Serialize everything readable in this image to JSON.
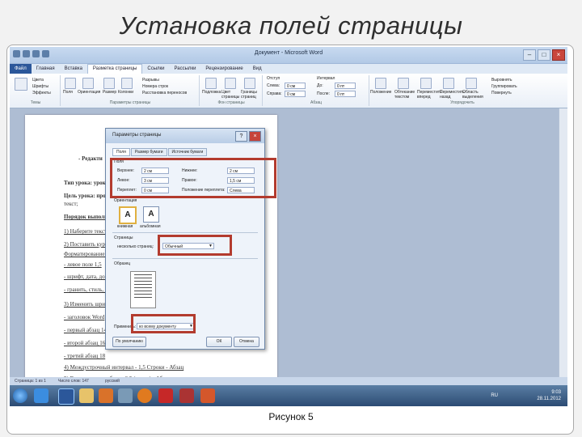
{
  "slide": {
    "title": "Установка полей страницы",
    "caption": "Рисунок 5"
  },
  "word": {
    "window_title": "Документ - Microsoft Word",
    "tabs": [
      "Файл",
      "Главная",
      "Вставка",
      "Разметка страницы",
      "Ссылки",
      "Рассылки",
      "Рецензирование",
      "Вид"
    ],
    "active_tab": "Разметка страницы",
    "ribbon": {
      "themes": {
        "label": "Темы",
        "items": [
          "Цвета",
          "Шрифты",
          "Эффекты"
        ]
      },
      "page_setup": {
        "label": "Параметры страницы",
        "items": [
          "Поля",
          "Ориентация",
          "Размер",
          "Колонки",
          "Разрывы",
          "Номера строк",
          "Расстановка переносов"
        ]
      },
      "page_background": {
        "label": "Фон страницы",
        "items": [
          "Подложка",
          "Цвет страницы",
          "Границы страниц"
        ]
      },
      "paragraph": {
        "label": "Абзац",
        "indent_label": "Отступ",
        "spacing_label": "Интервал",
        "left": "Слева:",
        "right": "Справа:",
        "before": "До:",
        "after": "После:",
        "left_val": "0 см",
        "right_val": "0 см",
        "before_val": "0 пт",
        "after_val": "0 пт"
      },
      "arrange": {
        "label": "Упорядочить",
        "items": [
          "Положение",
          "Обтекание текстом",
          "Переместить вперед",
          "Переместить назад",
          "Область выделения",
          "Выровнять",
          "Группировать",
          "Повернуть"
        ]
      }
    },
    "document_lines": [
      {
        "text": "- Редакти",
        "bold": true,
        "underline": false
      },
      {
        "text": "Тип урока: урок",
        "bold": true,
        "underline": false
      },
      {
        "text": "Цель урока: прод",
        "bold": true,
        "underline": false
      },
      {
        "text": "текст;",
        "bold": false,
        "underline": false
      },
      {
        "text": "Порядок выполн",
        "bold": true,
        "underline": true
      },
      {
        "text": "1) Наберите текст",
        "bold": false,
        "underline": true
      },
      {
        "text": "2) Поставить курс",
        "bold": false,
        "underline": true
      },
      {
        "text": "Форматирование абза",
        "bold": false,
        "underline": true
      },
      {
        "text": "- левое поле 1,5",
        "bold": false,
        "underline": true
      },
      {
        "text": "- шрифт, дата, докум",
        "bold": false,
        "underline": true
      },
      {
        "text": "- гранить, стиль, д",
        "bold": false,
        "underline": true
      },
      {
        "text": "3) Изменить шрифт",
        "bold": false,
        "underline": true
      },
      {
        "text": "- заголовок Word",
        "bold": false,
        "underline": true
      },
      {
        "text": "- первый абзац 14",
        "bold": false,
        "underline": true
      },
      {
        "text": "- второй абзац 16",
        "bold": false,
        "underline": true
      },
      {
        "text": "- третий абзац 18",
        "bold": false,
        "underline": true
      },
      {
        "text": "4) Междустрочный интервал - 1,5 Строки - Абзац",
        "bold": false,
        "underline": true
      },
      {
        "text": "5) Выделить весь абзац - 0,5 (центр) - Абзац",
        "bold": false,
        "underline": true
      }
    ],
    "status": {
      "page": "Страница: 1 из 1",
      "words": "Число слов: 147",
      "lang": "русский"
    },
    "tray": {
      "lang": "RU",
      "time": "9:03",
      "date": "28.11.2012"
    }
  },
  "dialog": {
    "title": "Параметры страницы",
    "help": "?",
    "close": "×",
    "tabs": [
      "Поля",
      "Размер бумаги",
      "Источник бумаги"
    ],
    "section_margins": "Поля",
    "top_label": "Верхнее:",
    "top_value": "2 см",
    "bottom_label": "Нижнее:",
    "bottom_value": "2 см",
    "left_label": "Левое:",
    "left_value": "3 см",
    "right_label": "Правое:",
    "right_value": "1,5 см",
    "gutter_label": "Переплет:",
    "gutter_value": "0 см",
    "gutter_pos_label": "Положение переплета:",
    "gutter_pos_value": "Слева",
    "orientation_label": "Ориентация",
    "portrait": "книжная",
    "landscape": "альбомная",
    "pages_label": "Страницы",
    "multiple_pages_label": "несколько страниц:",
    "multiple_pages_value": "Обычный",
    "preview_label": "Образец",
    "apply_label": "Применить:",
    "apply_value": "ко всему документу",
    "default_button": "По умолчанию",
    "ok_button": "ОК",
    "cancel_button": "Отмена"
  },
  "colors": {
    "highlight_box": "#b33b2e",
    "word_blue": "#2b579a"
  }
}
